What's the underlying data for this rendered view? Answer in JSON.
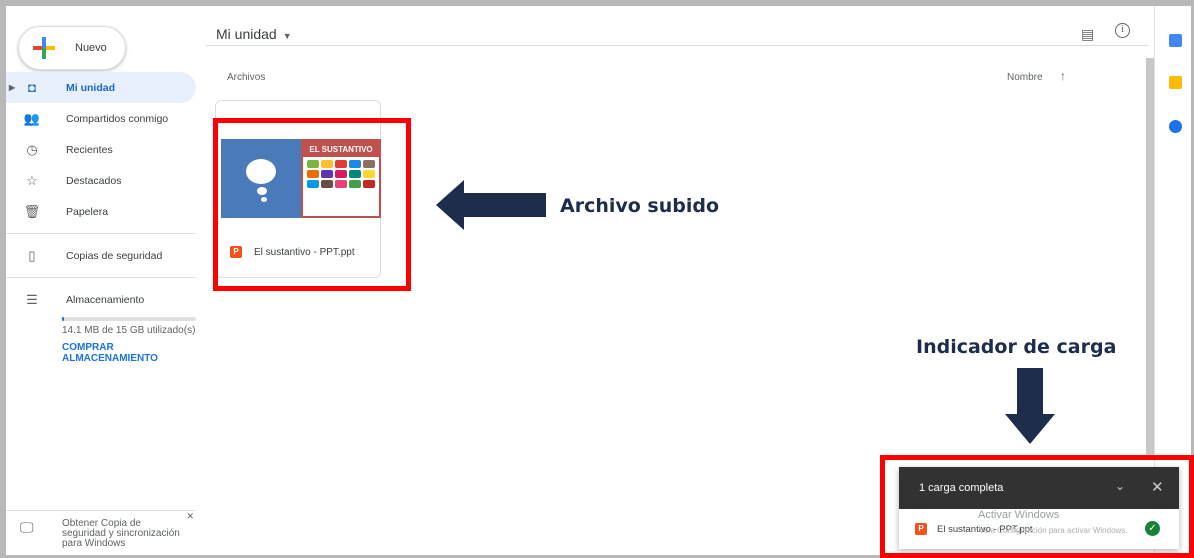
{
  "new_button": {
    "label": "Nuevo"
  },
  "sidebar": {
    "items": [
      {
        "label": "Mi unidad",
        "icon": "drive-icon"
      },
      {
        "label": "Compartidos conmigo",
        "icon": "people-icon"
      },
      {
        "label": "Recientes",
        "icon": "clock-icon"
      },
      {
        "label": "Destacados",
        "icon": "star-icon"
      },
      {
        "label": "Papelera",
        "icon": "trash-icon"
      },
      {
        "label": "Copias de seguridad",
        "icon": "backup-icon"
      },
      {
        "label": "Almacenamiento",
        "icon": "storage-icon"
      }
    ],
    "storage_used": "14.1 MB de 15 GB utilizado(s)",
    "buy_storage": "COMPRAR ALMACENAMIENTO",
    "backup_promo": "Obtener Copia de seguridad y sincronización para Windows"
  },
  "header": {
    "title": "Mi unidad"
  },
  "files": {
    "section_label": "Archivos",
    "sort_label": "Nombre",
    "items": [
      {
        "name": "El sustantivo - PPT.ppt",
        "thumbnail_title": "EL SUSTANTIVO"
      }
    ]
  },
  "annotations": {
    "file_callout": "Archivo subido",
    "upload_callout": "Indicador de carga"
  },
  "upload_panel": {
    "title": "1 carga completa",
    "file_name": "El sustantivo - PPT.ppt"
  },
  "watermark": {
    "line1": "Activar Windows",
    "line2": "Ve a Configuración para activar Windows."
  },
  "colors": {
    "accent": "#1a73e8",
    "highlight": "#ff0000",
    "arrow": "#1f2d4d",
    "ppt": "#f4511e"
  }
}
